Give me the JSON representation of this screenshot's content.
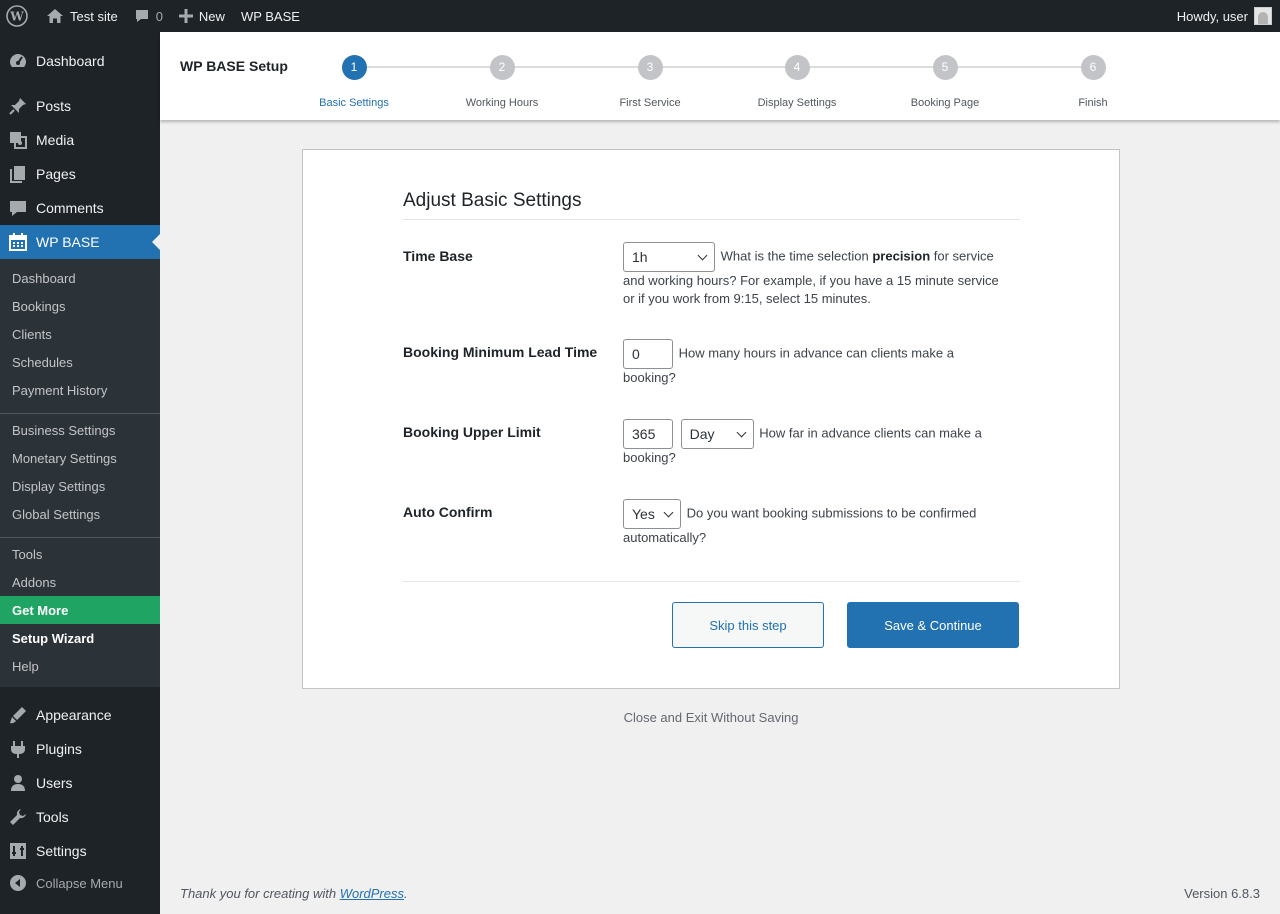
{
  "adminbar": {
    "site_name": "Test site",
    "comments_count": "0",
    "new_label": "New",
    "plugin_label": "WP BASE",
    "howdy": "Howdy, user"
  },
  "sidebar": {
    "top_items": [
      {
        "label": "Dashboard",
        "icon": "dashboard-icon"
      },
      {
        "label": "Posts",
        "icon": "pin-icon"
      },
      {
        "label": "Media",
        "icon": "media-icon"
      },
      {
        "label": "Pages",
        "icon": "pages-icon"
      },
      {
        "label": "Comments",
        "icon": "comment-icon"
      },
      {
        "label": "WP BASE",
        "icon": "calendar-icon"
      }
    ],
    "sub_items": [
      {
        "label": "Dashboard"
      },
      {
        "label": "Bookings"
      },
      {
        "label": "Clients"
      },
      {
        "label": "Schedules"
      },
      {
        "label": "Payment History"
      },
      {
        "label": "Business Settings"
      },
      {
        "label": "Monetary Settings"
      },
      {
        "label": "Display Settings"
      },
      {
        "label": "Global Settings"
      },
      {
        "label": "Tools"
      },
      {
        "label": "Addons"
      },
      {
        "label": "Get More"
      },
      {
        "label": "Setup Wizard"
      },
      {
        "label": "Help"
      }
    ],
    "bottom_items": [
      {
        "label": "Appearance",
        "icon": "appearance-icon"
      },
      {
        "label": "Plugins",
        "icon": "plugin-icon"
      },
      {
        "label": "Users",
        "icon": "users-icon"
      },
      {
        "label": "Tools",
        "icon": "tools-icon"
      },
      {
        "label": "Settings",
        "icon": "settings-icon"
      }
    ],
    "collapse_label": "Collapse Menu"
  },
  "setup": {
    "title": "WP BASE Setup",
    "steps": [
      {
        "num": "1",
        "label": "Basic Settings"
      },
      {
        "num": "2",
        "label": "Working Hours"
      },
      {
        "num": "3",
        "label": "First Service"
      },
      {
        "num": "4",
        "label": "Display Settings"
      },
      {
        "num": "5",
        "label": "Booking Page"
      },
      {
        "num": "6",
        "label": "Finish"
      }
    ],
    "active_step": "1"
  },
  "form": {
    "title": "Adjust Basic Settings",
    "time_base": {
      "label": "Time Base",
      "value": "1h",
      "desc_before": "What is the time selection ",
      "desc_bold": "precision",
      "desc_after": " for service and working hours? For example, if you have a 15 minute service or if you work from 9:15, select 15 minutes."
    },
    "lead_time": {
      "label": "Booking Minimum Lead Time",
      "value": "0",
      "desc": "How many hours in advance can clients make a booking?"
    },
    "upper_limit": {
      "label": "Booking Upper Limit",
      "value": "365",
      "unit": "Day",
      "desc": "How far in advance clients can make a booking?"
    },
    "auto_confirm": {
      "label": "Auto Confirm",
      "value": "Yes",
      "desc": "Do you want booking submissions to be confirmed automatically?"
    },
    "skip_label": "Skip this step",
    "save_label": "Save & Continue"
  },
  "exit_label": "Close and Exit Without Saving",
  "footer": {
    "thanks_before": "Thank you for creating with ",
    "thanks_link": "WordPress",
    "thanks_after": ".",
    "version": "Version 6.8.3"
  }
}
